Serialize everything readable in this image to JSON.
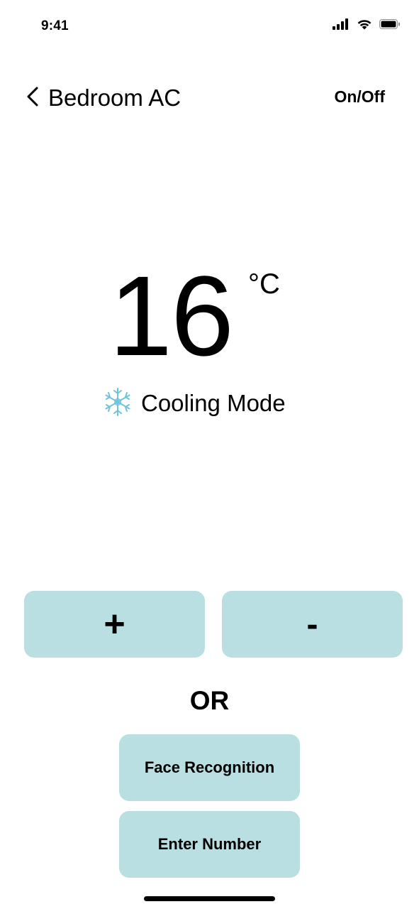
{
  "status_bar": {
    "time": "9:41",
    "icons": [
      "signal-icon",
      "wifi-icon",
      "battery-icon"
    ]
  },
  "header": {
    "back_icon": "chevron-left-icon",
    "title": "Bedroom AC",
    "power_label": "On/Off"
  },
  "temperature": {
    "value": "16",
    "unit": "°C"
  },
  "mode": {
    "icon": "snowflake-icon",
    "label": "Cooling Mode",
    "icon_color": "#6fc3dc"
  },
  "controls": {
    "increase_label": "+",
    "decrease_label": "-",
    "or_label": "OR",
    "face_recognition_label": "Face Recognition",
    "enter_number_label": "Enter Number"
  },
  "colors": {
    "button_bg": "#b9dfe2",
    "text": "#000000",
    "background": "#ffffff"
  }
}
